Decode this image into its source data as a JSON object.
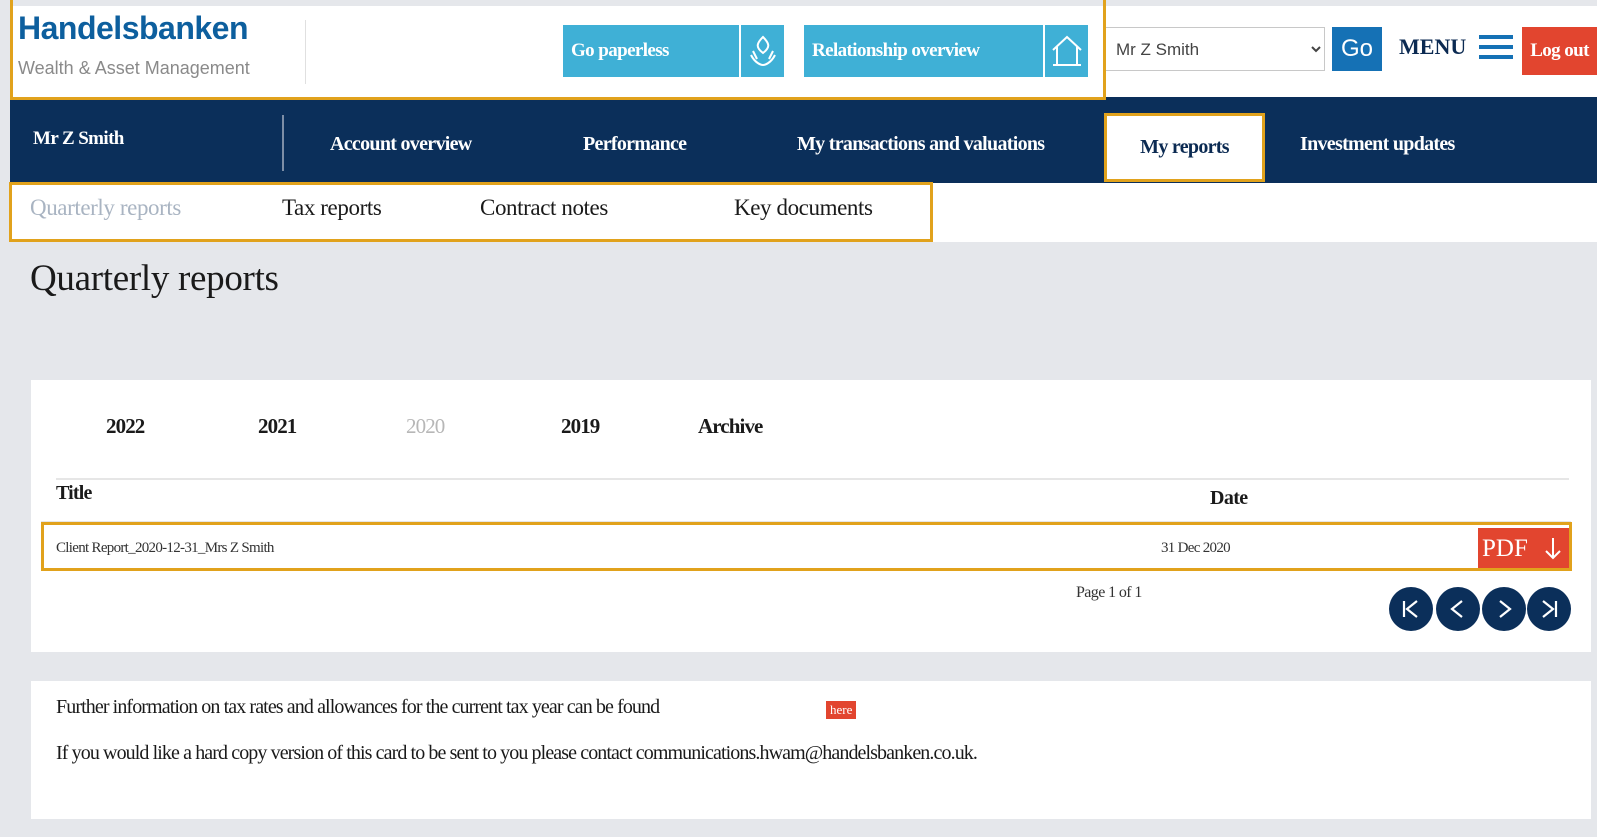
{
  "brand": {
    "name": "Handelsbanken",
    "subtitle": "Wealth & Asset Management"
  },
  "header": {
    "go_paperless": "Go paperless",
    "relationship_overview": "Relationship overview",
    "client_select": {
      "selected": "Mr Z Smith",
      "options": [
        "Mr Z Smith"
      ]
    },
    "go_label": "Go",
    "menu_label": "MENU",
    "logout_label": "Log out"
  },
  "nav": {
    "user": "Mr Z Smith",
    "items": [
      {
        "label": "Account overview"
      },
      {
        "label": "Performance"
      },
      {
        "label": "My transactions and valuations"
      },
      {
        "label": "My reports",
        "active": true
      },
      {
        "label": "Investment updates"
      }
    ]
  },
  "subnav": {
    "items": [
      {
        "label": "Quarterly reports",
        "active": true
      },
      {
        "label": "Tax reports"
      },
      {
        "label": "Contract notes"
      },
      {
        "label": "Key documents"
      }
    ]
  },
  "page_title": "Quarterly reports",
  "reports": {
    "year_tabs": [
      {
        "label": "2022"
      },
      {
        "label": "2021"
      },
      {
        "label": "2020",
        "active": true
      },
      {
        "label": "2019"
      },
      {
        "label": "Archive"
      }
    ],
    "columns": {
      "title": "Title",
      "date": "Date"
    },
    "rows": [
      {
        "title": "Client Report_2020-12-31_Mrs Z Smith",
        "date": "31 Dec 2020",
        "action": "PDF"
      }
    ],
    "pagination": {
      "text": "Page 1 of 1",
      "buttons": [
        "first-page-icon",
        "previous-page-icon",
        "next-page-icon",
        "last-page-icon"
      ]
    }
  },
  "info": {
    "tax_line": "Further information on tax rates and allowances for the current tax year can be found",
    "here_link": "here",
    "contact_line": "If you would like a hard copy version of this card to be sent to you please contact communications.hwam@handelsbanken.co.uk."
  },
  "colors": {
    "navy": "#0b2f5a",
    "teal": "#3fb0d6",
    "brand_blue": "#0d5f9e",
    "red": "#e2452f",
    "highlight": "#e1a21c",
    "background": "#e5e7eb"
  }
}
